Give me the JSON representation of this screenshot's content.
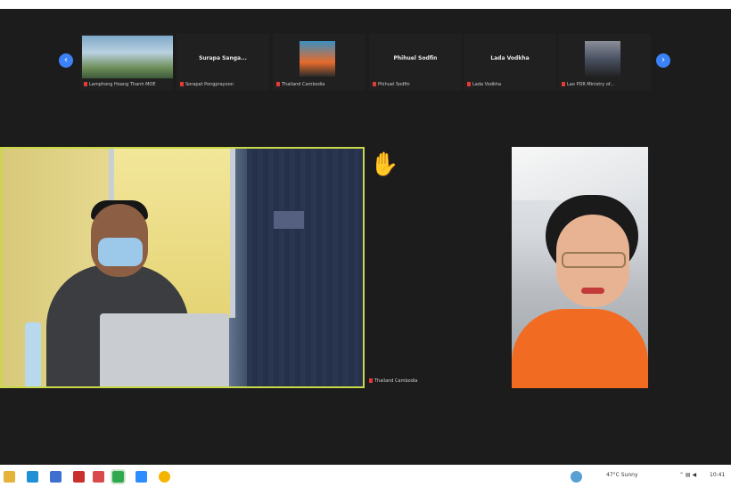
{
  "gallery": {
    "prev_icon": "chevron-left-icon",
    "next_icon": "chevron-right-icon",
    "participants": [
      {
        "name": "Lamphong Hoang Thanh MOE",
        "has_video": true
      },
      {
        "name": "Sorapat Pongprayoon",
        "label_center": "Surapa Sanga...",
        "has_video": false
      },
      {
        "name": "Thailand Cambodia",
        "has_video": true
      },
      {
        "name": "Phihuel Sodfin",
        "label_center": "Phihuel Sodfin",
        "has_video": false
      },
      {
        "name": "Lada Vodkha",
        "label_center": "Lada Vodkha",
        "has_video": false
      },
      {
        "name": "Lao PDR Ministry of...",
        "has_video": true
      }
    ]
  },
  "stage": {
    "raise_hand_icon": "raised-hand-icon",
    "active_speaker_name": "Thailand Cambodia",
    "active_border_color": "#c9d84a"
  },
  "taskbar": {
    "icons": [
      "folder-icon",
      "edge-icon",
      "store-icon",
      "mail-icon",
      "zoom-icon",
      "chat-icon",
      "photos-icon",
      "chrome-icon"
    ],
    "tray_text": "47°C Sunny",
    "clock": "10:41"
  }
}
